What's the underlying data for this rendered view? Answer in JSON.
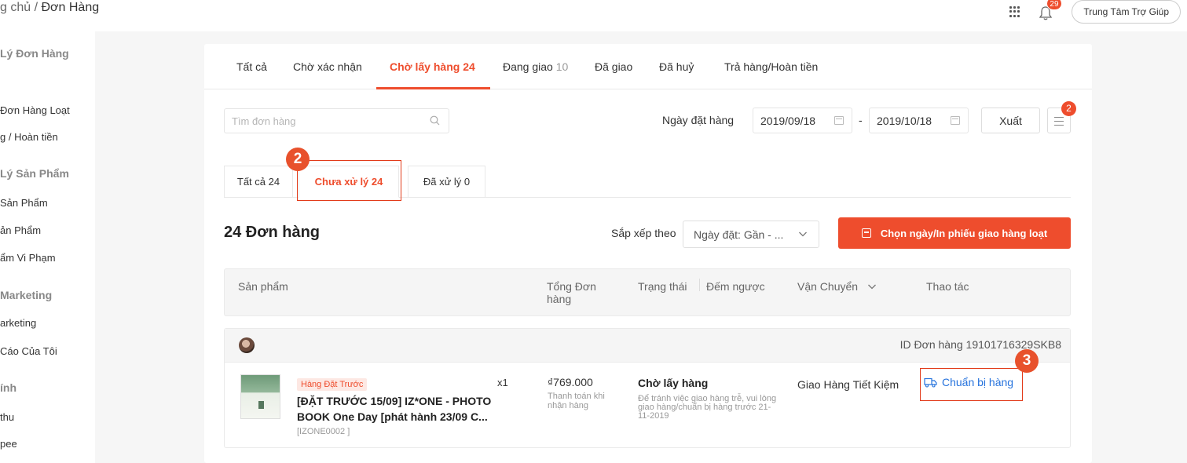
{
  "header": {
    "breadcrumb_home": "g chủ",
    "breadcrumb_sep": " / ",
    "breadcrumb_current": "Đơn Hàng",
    "notification_count": "29",
    "help_label": "Trung Tâm Trợ Giúp",
    "icons": [
      "apps-grid-icon",
      "bell-icon"
    ]
  },
  "sidebar": {
    "items": [
      {
        "label": "Lý Đơn Hàng",
        "heading": true
      },
      {
        "label": "Đơn Hàng Loạt",
        "heading": false
      },
      {
        "label": "g / Hoàn tiền",
        "heading": false
      },
      {
        "label": "Lý Sản Phẩm",
        "heading": true
      },
      {
        "label": "Sản Phẩm",
        "heading": false
      },
      {
        "label": "ản Phẩm",
        "heading": false
      },
      {
        "label": "ẩm Vi Phạm",
        "heading": false
      },
      {
        "label": "Marketing",
        "heading": true
      },
      {
        "label": "arketing",
        "heading": false
      },
      {
        "label": "Cáo Của Tôi",
        "heading": false
      },
      {
        "label": "ính",
        "heading": true
      },
      {
        "label": "thu",
        "heading": false
      },
      {
        "label": "pee",
        "heading": false
      }
    ]
  },
  "tabs": [
    {
      "label": "Tất cả",
      "count": ""
    },
    {
      "label": "Chờ xác nhận",
      "count": ""
    },
    {
      "label": "Chờ lấy hàng",
      "count": "24",
      "active": true
    },
    {
      "label": "Đang giao",
      "count": "10"
    },
    {
      "label": "Đã giao",
      "count": ""
    },
    {
      "label": "Đã huỷ",
      "count": ""
    },
    {
      "label": "Trả hàng/Hoàn tiền",
      "count": ""
    }
  ],
  "filters": {
    "search_placeholder": "Tìm đơn hàng",
    "date_label": "Ngày đặt hàng",
    "date_from": "2019/09/18",
    "date_sep": "-",
    "date_to": "2019/10/18",
    "export_label": "Xuất",
    "list_badge": "2"
  },
  "subtabs": [
    {
      "label": "Tất cả 24"
    },
    {
      "label": "Chưa xử lý 24",
      "active": true
    },
    {
      "label": "Đã xử lý 0"
    }
  ],
  "annotations": {
    "step2": "2",
    "step3": "3"
  },
  "orders_bar": {
    "title": "24 Đơn hàng",
    "sort_label": "Sắp xếp theo",
    "sort_value": "Ngày đặt: Gần - ...",
    "batch_button": "Chọn ngày/In phiếu giao hàng loạt"
  },
  "table_headers": {
    "product": "Sản phẩm",
    "total_line1": "Tổng Đơn",
    "total_line2": "hàng",
    "status": "Trạng thái",
    "countdown": "Đếm ngược",
    "shipping": "Vận Chuyển",
    "actions": "Thao tác"
  },
  "order": {
    "id_text": "ID Đơn hàng 19101716329SKB8",
    "tag": "Hàng Đặt Trước",
    "quantity": "x1",
    "name_line1": "[ĐẶT TRƯỚC 15/09] IZ*ONE - PHOTO",
    "name_line2": "BOOK One Day [phát hành 23/09 C...",
    "sku": "[IZONE0002 ]",
    "price": "₫769.000",
    "payment_note": "Thanh toán khi nhận hàng",
    "status": "Chờ lấy hàng",
    "status_note": "Để tránh việc giao hàng trễ, vui lòng giao hàng/chuẩn bị hàng trước 21-11-2019",
    "carrier": "Giao Hàng Tiết Kiệm",
    "action_label": "Chuẩn bị hàng"
  },
  "colors": {
    "accent": "#ee4d2d",
    "link": "#2673dd",
    "annotation": "#e8512c"
  }
}
